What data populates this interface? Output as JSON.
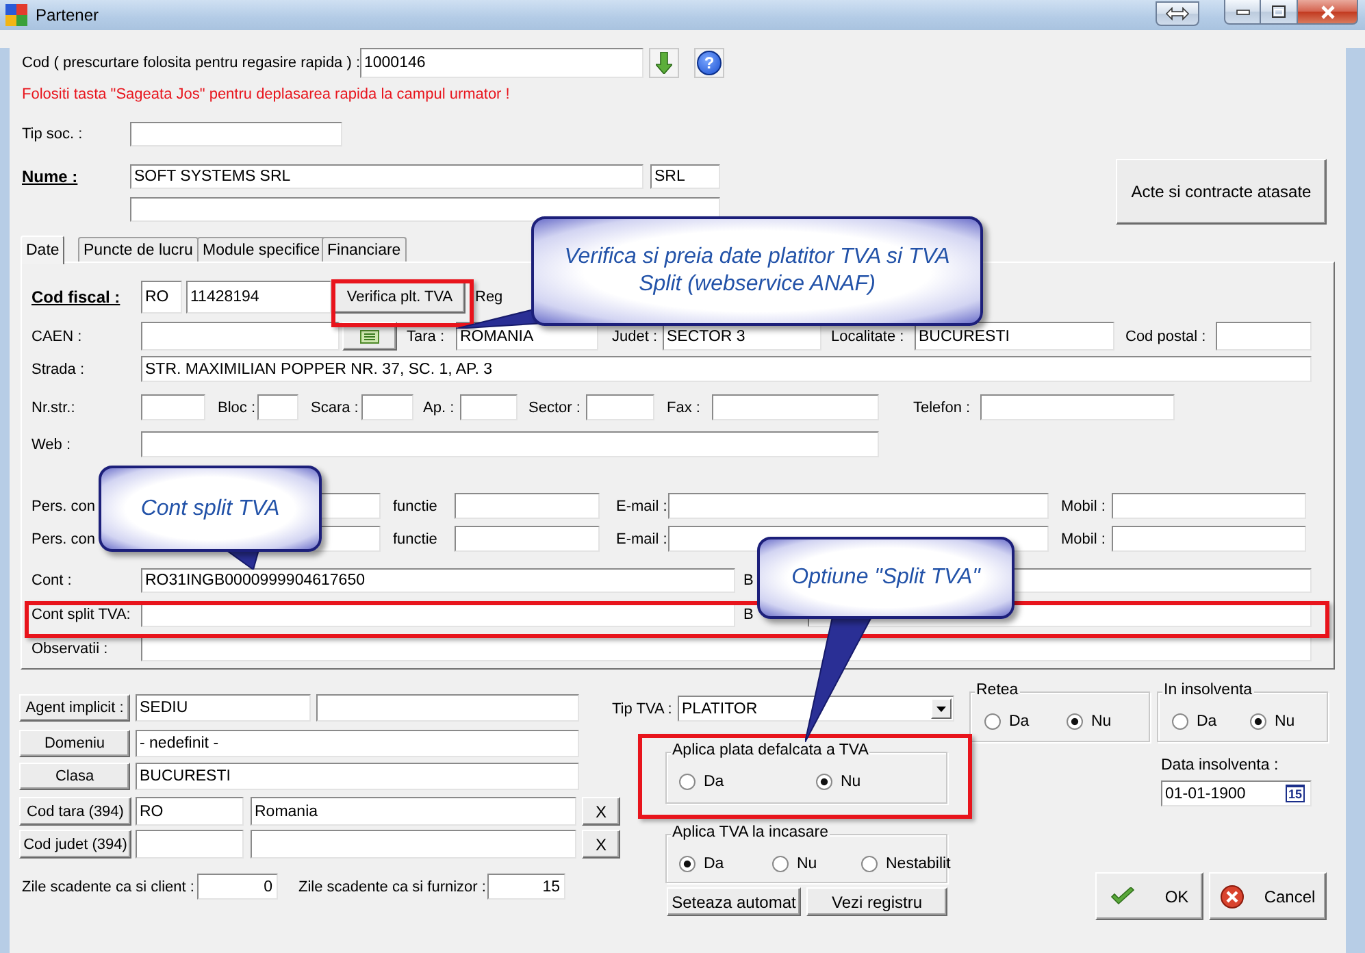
{
  "window": {
    "title": "Partener"
  },
  "header": {
    "code_label": "Cod ( prescurtare folosita pentru regasire rapida ) :",
    "code_value": "1000146",
    "help_button": "?",
    "hint": "Folositi tasta \"Sageata Jos\" pentru deplasarea rapida la campul urmator !",
    "company_type_label": "Tip soc. :",
    "name_label": "Nume :",
    "name_value": "SOFT SYSTEMS SRL",
    "legal_form": "SRL",
    "attachments_button": "Acte si contracte atasate"
  },
  "tabs": [
    {
      "label": "Date",
      "selected": true
    },
    {
      "label": "Puncte de lucru",
      "selected": false
    },
    {
      "label": "Module specifice",
      "selected": false
    },
    {
      "label": "Financiare",
      "selected": false
    }
  ],
  "panel_rows": [
    [
      {
        "kind": "key_label",
        "text": "Cod fiscal :"
      },
      {
        "kind": "field",
        "value": "RO"
      },
      {
        "kind": "field",
        "value": "11428194"
      },
      {
        "kind": "button",
        "text": "Verifica plt. TVA"
      },
      {
        "kind": "label",
        "text": "Reg"
      }
    ],
    [
      {
        "kind": "label",
        "text": "CAEN :"
      },
      {
        "kind": "field"
      },
      {
        "kind": "list_button"
      },
      {
        "kind": "label",
        "text": "Tara :"
      },
      {
        "kind": "field",
        "value": "ROMANIA"
      },
      {
        "kind": "label",
        "text": "Judet :"
      },
      {
        "kind": "field",
        "value": "SECTOR 3"
      },
      {
        "kind": "label",
        "text": "Localitate :"
      },
      {
        "kind": "field",
        "value": "BUCURESTI"
      },
      {
        "kind": "label",
        "text": "Cod postal :"
      },
      {
        "kind": "field"
      }
    ],
    [
      {
        "kind": "label",
        "text": "Strada :"
      },
      {
        "kind": "field",
        "value": "STR. MAXIMILIAN POPPER NR. 37, SC. 1, AP. 3"
      }
    ],
    [
      {
        "kind": "label",
        "text": "Nr.str.:"
      },
      {
        "kind": "field"
      },
      {
        "kind": "label",
        "text": "Bloc :"
      },
      {
        "kind": "field"
      },
      {
        "kind": "label",
        "text": "Scara :"
      },
      {
        "kind": "field"
      },
      {
        "kind": "label",
        "text": "Ap. :"
      },
      {
        "kind": "field"
      },
      {
        "kind": "label",
        "text": "Sector :"
      },
      {
        "kind": "field"
      },
      {
        "kind": "label",
        "text": "Fax :"
      },
      {
        "kind": "field"
      },
      {
        "kind": "label",
        "text": "Telefon :"
      },
      {
        "kind": "field"
      }
    ],
    [
      {
        "kind": "label",
        "text": "Web :"
      },
      {
        "kind": "field"
      }
    ],
    [
      {
        "kind": "label",
        "text": "Pers. con"
      },
      {
        "kind": "field"
      },
      {
        "kind": "label",
        "text": "functie"
      },
      {
        "kind": "field"
      },
      {
        "kind": "label",
        "text": "E-mail :"
      },
      {
        "kind": "field"
      },
      {
        "kind": "label",
        "text": "Mobil :"
      },
      {
        "kind": "field"
      }
    ],
    [
      {
        "kind": "label",
        "text": "Pers. con"
      },
      {
        "kind": "field"
      },
      {
        "kind": "label",
        "text": "functie"
      },
      {
        "kind": "field"
      },
      {
        "kind": "label",
        "text": "E-mail :"
      },
      {
        "kind": "field"
      },
      {
        "kind": "label",
        "text": "Mobil :"
      },
      {
        "kind": "field"
      }
    ],
    [
      {
        "kind": "label",
        "text": "Cont :"
      },
      {
        "kind": "field",
        "value": "RO31INGB0000999904617650"
      },
      {
        "kind": "label",
        "text": "B"
      },
      {
        "kind": "field"
      }
    ],
    [
      {
        "kind": "label",
        "text": "Cont split TVA:"
      },
      {
        "kind": "field"
      },
      {
        "kind": "label",
        "text": "B"
      },
      {
        "kind": "field"
      }
    ],
    [
      {
        "kind": "label",
        "text": "Observatii :"
      },
      {
        "kind": "field"
      }
    ]
  ],
  "lookup_rows": [
    [
      {
        "kind": "lookup",
        "text": "Agent implicit :"
      },
      {
        "kind": "field",
        "value": "SEDIU"
      },
      {
        "kind": "field"
      }
    ],
    [
      {
        "kind": "lookup",
        "text": "Domeniu"
      },
      {
        "kind": "field",
        "value": "- nedefinit -"
      }
    ],
    [
      {
        "kind": "lookup",
        "text": "Clasa"
      },
      {
        "kind": "field",
        "value": "BUCURESTI"
      }
    ],
    [
      {
        "kind": "lookup",
        "text": "Cod tara (394)"
      },
      {
        "kind": "field",
        "value": "RO"
      },
      {
        "kind": "field",
        "value": "Romania"
      },
      {
        "kind": "clear",
        "text": "X"
      }
    ],
    [
      {
        "kind": "lookup",
        "text": "Cod judet (394)"
      },
      {
        "kind": "field"
      },
      {
        "kind": "field"
      },
      {
        "kind": "clear",
        "text": "X"
      }
    ],
    [
      {
        "kind": "label",
        "text": "Zile scadente ca si client :"
      },
      {
        "kind": "number_field",
        "value": "0"
      },
      {
        "kind": "label",
        "text": "Zile scadente ca si furnizor :"
      },
      {
        "kind": "number_field",
        "value": "15"
      }
    ]
  ],
  "vat": {
    "label": "Tip TVA :",
    "value": "PLATITOR"
  },
  "option_groups": [
    {
      "title": "Aplica plata defalcata a TVA",
      "options": [
        {
          "label": "Da",
          "selected": false
        },
        {
          "label": "Nu",
          "selected": true
        }
      ]
    },
    {
      "title": "Aplica TVA la incasare",
      "options": [
        {
          "label": "Da",
          "selected": true
        },
        {
          "label": "Nu",
          "selected": false
        },
        {
          "label": "Nestabilit",
          "selected": false
        }
      ]
    },
    {
      "title": "Retea",
      "options": [
        {
          "label": "Da",
          "selected": false
        },
        {
          "label": "Nu",
          "selected": true
        }
      ]
    },
    {
      "title": "In insolventa",
      "options": [
        {
          "label": "Da",
          "selected": false
        },
        {
          "label": "Nu",
          "selected": true
        }
      ]
    }
  ],
  "vat_buttons": [
    "Seteaza automat",
    "Vezi registru"
  ],
  "insolvency_date": {
    "label": "Data insolventa :",
    "value": "01-01-1900",
    "calendar_button": "15"
  },
  "dialog_buttons": [
    {
      "kind": "ok",
      "label": "OK"
    },
    {
      "kind": "cancel",
      "label": "Cancel"
    }
  ],
  "callouts": [
    {
      "text": "Verifica si preia date platitor TVA si TVA Split (webservice ANAF)"
    },
    {
      "text": "Cont split TVA"
    },
    {
      "text": "Optiune \"Split TVA\""
    }
  ]
}
